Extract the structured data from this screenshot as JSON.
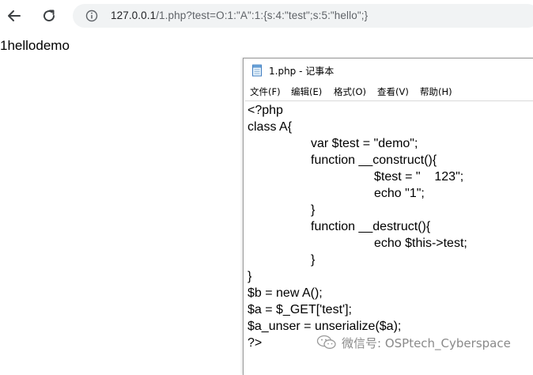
{
  "browser": {
    "back_icon": "arrow-left-icon",
    "reload_icon": "reload-icon",
    "info_icon": "info-circle-icon",
    "url_host": "127.0.0.1",
    "url_rest": "/1.php?test=O:1:\"A\":1:{s:4:\"test\";s:5:\"hello\";}"
  },
  "page_output": "1hellodemo",
  "notepad": {
    "icon": "notepad-icon",
    "title": "1.php - 记事本",
    "menu": [
      "文件(F)",
      "编辑(E)",
      "格式(O)",
      "查看(V)",
      "帮助(H)"
    ],
    "code_lines": [
      "<?php",
      "class A{",
      "var $test = \"demo\";",
      "function __construct(){",
      "$test = \"    123\";",
      "echo \"1\";",
      "}",
      "function __destruct(){",
      "echo $this->test;",
      "}",
      "}",
      "$b = new A();",
      "$a = $_GET['test'];",
      "$a_unser = unserialize($a);",
      "?>"
    ]
  },
  "watermark": {
    "icon": "wechat-icon",
    "text": "微信号: OSPtech_Cyberspace"
  }
}
